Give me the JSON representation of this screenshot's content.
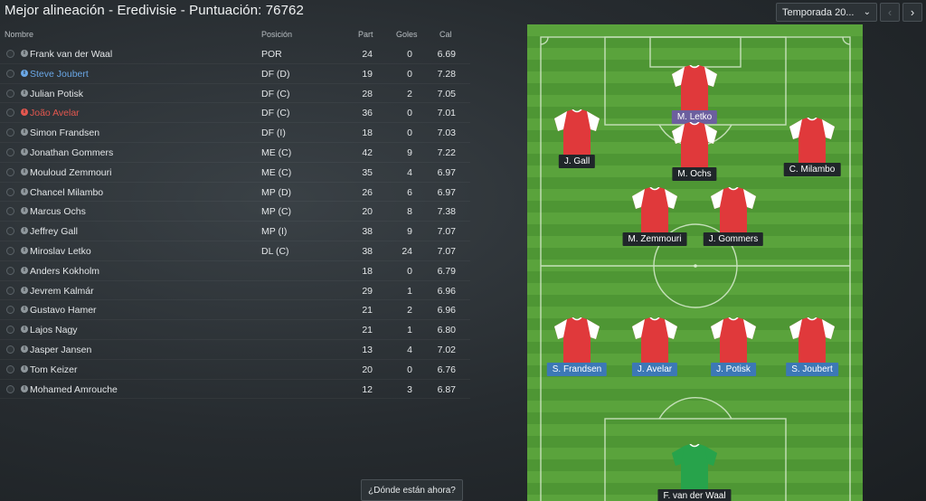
{
  "title": "Mejor alineación - Eredivisie - Puntuación: 76762",
  "season_select": "Temporada 20...",
  "columns": {
    "name": "Nombre",
    "pos": "Posición",
    "part": "Part",
    "goles": "Goles",
    "cal": "Cal"
  },
  "players": [
    {
      "name": "Frank van der Waal",
      "pos": "POR",
      "part": "24",
      "goles": "0",
      "cal": "6.69"
    },
    {
      "name": "Steve Joubert",
      "pos": "DF (D)",
      "part": "19",
      "goles": "0",
      "cal": "7.28"
    },
    {
      "name": "Julian Potisk",
      "pos": "DF (C)",
      "part": "28",
      "goles": "2",
      "cal": "7.05"
    },
    {
      "name": "João Avelar",
      "pos": "DF (C)",
      "part": "36",
      "goles": "0",
      "cal": "7.01"
    },
    {
      "name": "Simon Frandsen",
      "pos": "DF (I)",
      "part": "18",
      "goles": "0",
      "cal": "7.03"
    },
    {
      "name": "Jonathan Gommers",
      "pos": "ME (C)",
      "part": "42",
      "goles": "9",
      "cal": "7.22"
    },
    {
      "name": "Mouloud Zemmouri",
      "pos": "ME (C)",
      "part": "35",
      "goles": "4",
      "cal": "6.97"
    },
    {
      "name": "Chancel Milambo",
      "pos": "MP (D)",
      "part": "26",
      "goles": "6",
      "cal": "6.97"
    },
    {
      "name": "Marcus Ochs",
      "pos": "MP (C)",
      "part": "20",
      "goles": "8",
      "cal": "7.38"
    },
    {
      "name": "Jeffrey Gall",
      "pos": "MP (I)",
      "part": "38",
      "goles": "9",
      "cal": "7.07"
    },
    {
      "name": "Miroslav Letko",
      "pos": "DL (C)",
      "part": "38",
      "goles": "24",
      "cal": "7.07"
    },
    {
      "name": "Anders Kokholm",
      "pos": "",
      "part": "18",
      "goles": "0",
      "cal": "6.79"
    },
    {
      "name": "Jevrem Kalmár",
      "pos": "",
      "part": "29",
      "goles": "1",
      "cal": "6.96"
    },
    {
      "name": "Gustavo Hamer",
      "pos": "",
      "part": "21",
      "goles": "2",
      "cal": "6.96"
    },
    {
      "name": "Lajos Nagy",
      "pos": "",
      "part": "21",
      "goles": "1",
      "cal": "6.80"
    },
    {
      "name": "Jasper Jansen",
      "pos": "",
      "part": "13",
      "goles": "4",
      "cal": "7.02"
    },
    {
      "name": "Tom Keizer",
      "pos": "",
      "part": "20",
      "goles": "0",
      "cal": "6.76"
    },
    {
      "name": "Mohamed Amrouche",
      "pos": "",
      "part": "12",
      "goles": "3",
      "cal": "6.87"
    }
  ],
  "pitch_labels": {
    "letko": "M. Letko",
    "gall": "J. Gall",
    "ochs": "M. Ochs",
    "milambo": "C. Milambo",
    "zemmouri": "M. Zemmouri",
    "gommers": "J. Gommers",
    "frandsen": "S. Frandsen",
    "avelar": "J. Avelar",
    "potisk": "J. Potisk",
    "joubert": "S. Joubert",
    "keeper": "F. van der Waal"
  },
  "where_button": "¿Dónde están ahora?",
  "colors": {
    "name_blue": "#6aa7e6",
    "name_red": "#e4574f",
    "shirt_red": "#e0393b",
    "keeper_green": "#27a34b"
  }
}
